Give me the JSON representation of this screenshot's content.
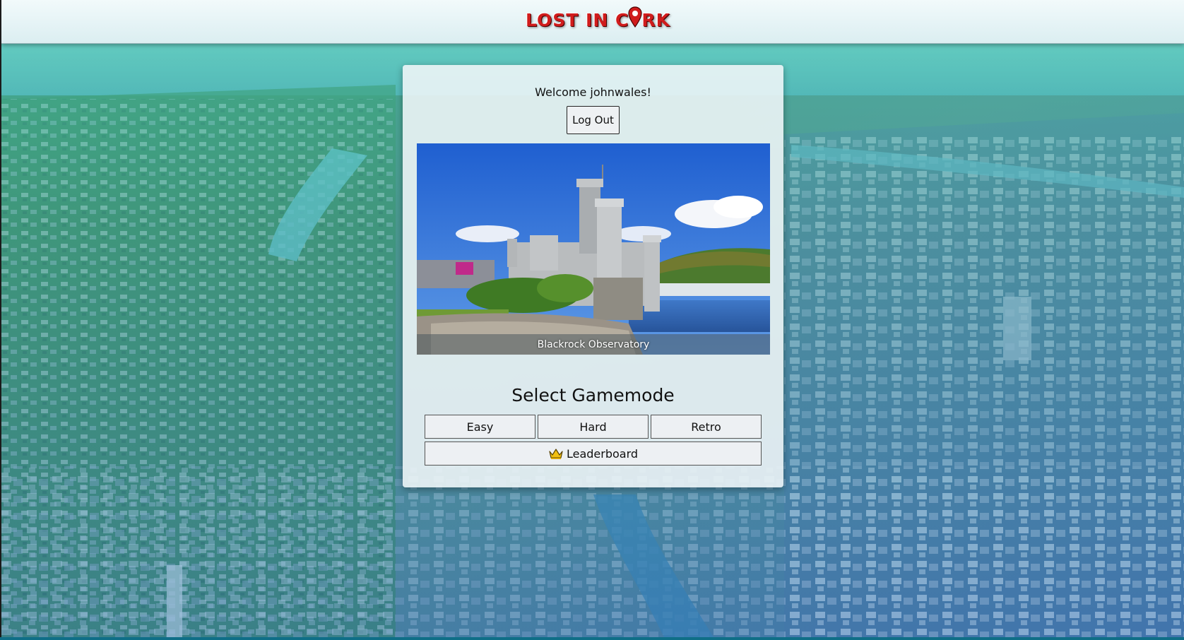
{
  "header": {
    "logo_part1": "LOST IN C",
    "logo_part2": "RK"
  },
  "card": {
    "welcome_text": "Welcome johnwales!",
    "logout_label": "Log Out",
    "photo_caption": "Blackrock Observatory",
    "select_title": "Select Gamemode",
    "modes": [
      {
        "label": "Easy"
      },
      {
        "label": "Hard"
      },
      {
        "label": "Retro"
      }
    ],
    "leaderboard_label": "Leaderboard"
  },
  "icons": {
    "logo_pin": "map-pin-icon",
    "leaderboard": "crown-icon"
  },
  "colors": {
    "logo_red": "#d01c1c",
    "header_bg": "#e6f4f6",
    "card_bg": "#f0f6f8"
  }
}
